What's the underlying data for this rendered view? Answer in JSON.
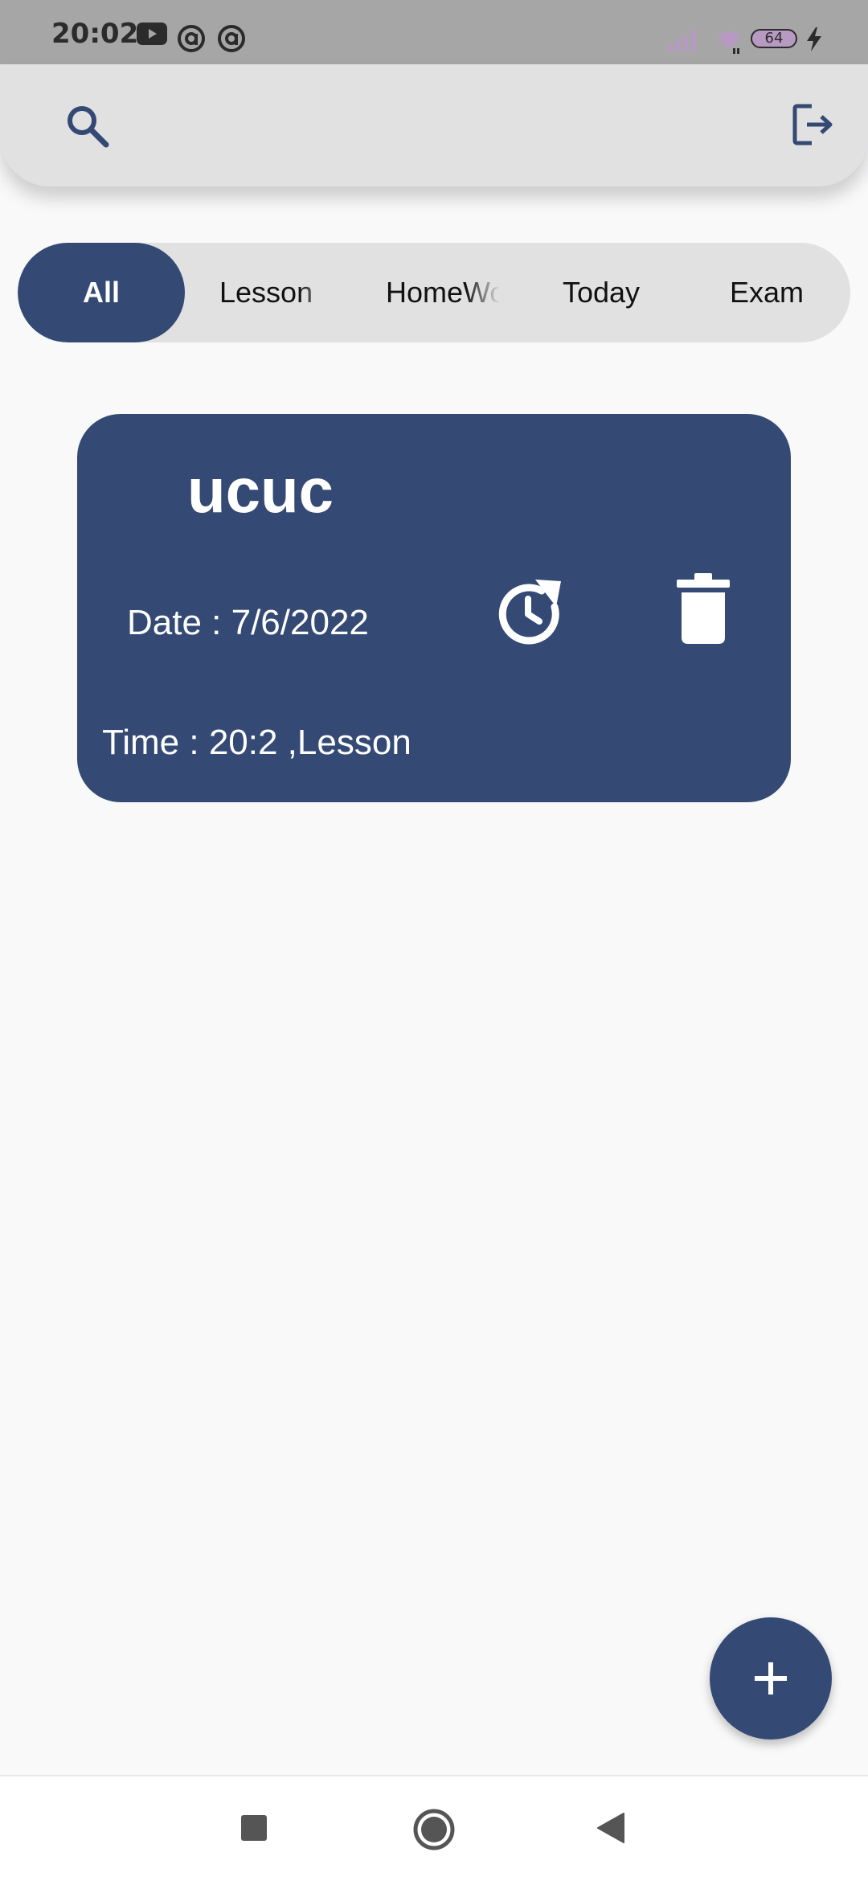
{
  "status_bar": {
    "time": "20:02",
    "battery": "64",
    "icons": [
      "youtube-icon",
      "at-sign-icon",
      "at-sign-icon",
      "signal-icon",
      "wifi-icon",
      "charging-icon"
    ]
  },
  "app_bar": {
    "left_icon": "search-icon",
    "right_icon": "logout-icon"
  },
  "tabs": [
    {
      "label": "All",
      "active": true
    },
    {
      "label": "Lesson",
      "active": false
    },
    {
      "label": "HomeWork",
      "active": false
    },
    {
      "label": "Today",
      "active": false
    },
    {
      "label": "Exam",
      "active": false
    }
  ],
  "card": {
    "title": "ucuc",
    "date": "Date : 7/6/2022",
    "time": "Time : 20:2 ,Lesson",
    "actions": [
      "reschedule-icon",
      "delete-icon"
    ]
  },
  "fab": {
    "icon": "plus-icon"
  },
  "nav_bar": {
    "buttons": [
      "recents-icon",
      "home-icon",
      "back-icon"
    ]
  },
  "colors": {
    "primary": "#344a74",
    "app_bar_bg": "#e1e1e2",
    "page_bg": "#f9f9fa",
    "status_bar_bg": "#a6a6a7"
  }
}
